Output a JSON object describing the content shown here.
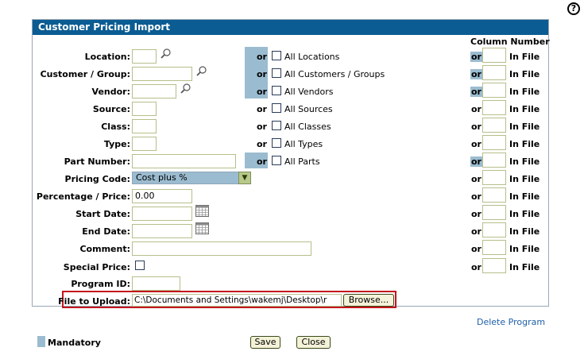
{
  "help": {
    "icon": "help-icon",
    "glyph": "?"
  },
  "panel": {
    "title": "Customer Pricing Import"
  },
  "column_number_header": "Column Number",
  "rows": {
    "location": {
      "label": "Location:",
      "value": "",
      "or": "or",
      "all_label": "All Locations",
      "or_right": "or",
      "in_file": "In File",
      "mandatory": true
    },
    "customer_group": {
      "label": "Customer / Group:",
      "value": "",
      "or": "or",
      "all_label": "All Customers / Groups",
      "or_right": "or",
      "in_file": "In File",
      "mandatory": true
    },
    "vendor": {
      "label": "Vendor:",
      "value": "",
      "or": "or",
      "all_label": "All Vendors",
      "or_right": "or",
      "in_file": "In File",
      "mandatory": true
    },
    "source": {
      "label": "Source:",
      "value": "",
      "or": "or",
      "all_label": "All Sources",
      "or_right": "or",
      "in_file": "In File"
    },
    "class": {
      "label": "Class:",
      "value": "",
      "or": "or",
      "all_label": "All Classes",
      "or_right": "or",
      "in_file": "In File"
    },
    "type": {
      "label": "Type:",
      "value": "",
      "or": "or",
      "all_label": "All Types",
      "or_right": "or",
      "in_file": "In File"
    },
    "part_number": {
      "label": "Part Number:",
      "value": "",
      "or": "or",
      "all_label": "All Parts",
      "or_right": "or",
      "in_file": "In File",
      "mandatory": true
    },
    "pricing_code": {
      "label": "Pricing Code:",
      "selected": "Cost plus %",
      "or_right": "or",
      "in_file": "In File"
    },
    "percentage_price": {
      "label": "Percentage / Price:",
      "value": "0.00",
      "or_right": "or",
      "in_file": "In File"
    },
    "start_date": {
      "label": "Start Date:",
      "value": "",
      "or_right": "or",
      "in_file": "In File"
    },
    "end_date": {
      "label": "End Date:",
      "value": "",
      "or_right": "or",
      "in_file": "In File"
    },
    "comment": {
      "label": "Comment:",
      "value": "",
      "or_right": "or",
      "in_file": "In File"
    },
    "special_price": {
      "label": "Special Price:",
      "or_right": "or",
      "in_file": "In File"
    },
    "program_id": {
      "label": "Program ID:",
      "value": ""
    },
    "file_upload": {
      "label": "File to Upload:",
      "value": "C:\\Documents and Settings\\wakemj\\Desktop\\r",
      "browse_label": "Browse..."
    }
  },
  "delete_program": "Delete Program",
  "legend": {
    "mandatory_label": "Mandatory"
  },
  "buttons": {
    "save": "Save",
    "close": "Close"
  },
  "colors": {
    "header_bg": "#0b5c92",
    "mandatory": "#9bbcd0",
    "highlight_border": "#c4161c",
    "link": "#1f5fa8"
  }
}
